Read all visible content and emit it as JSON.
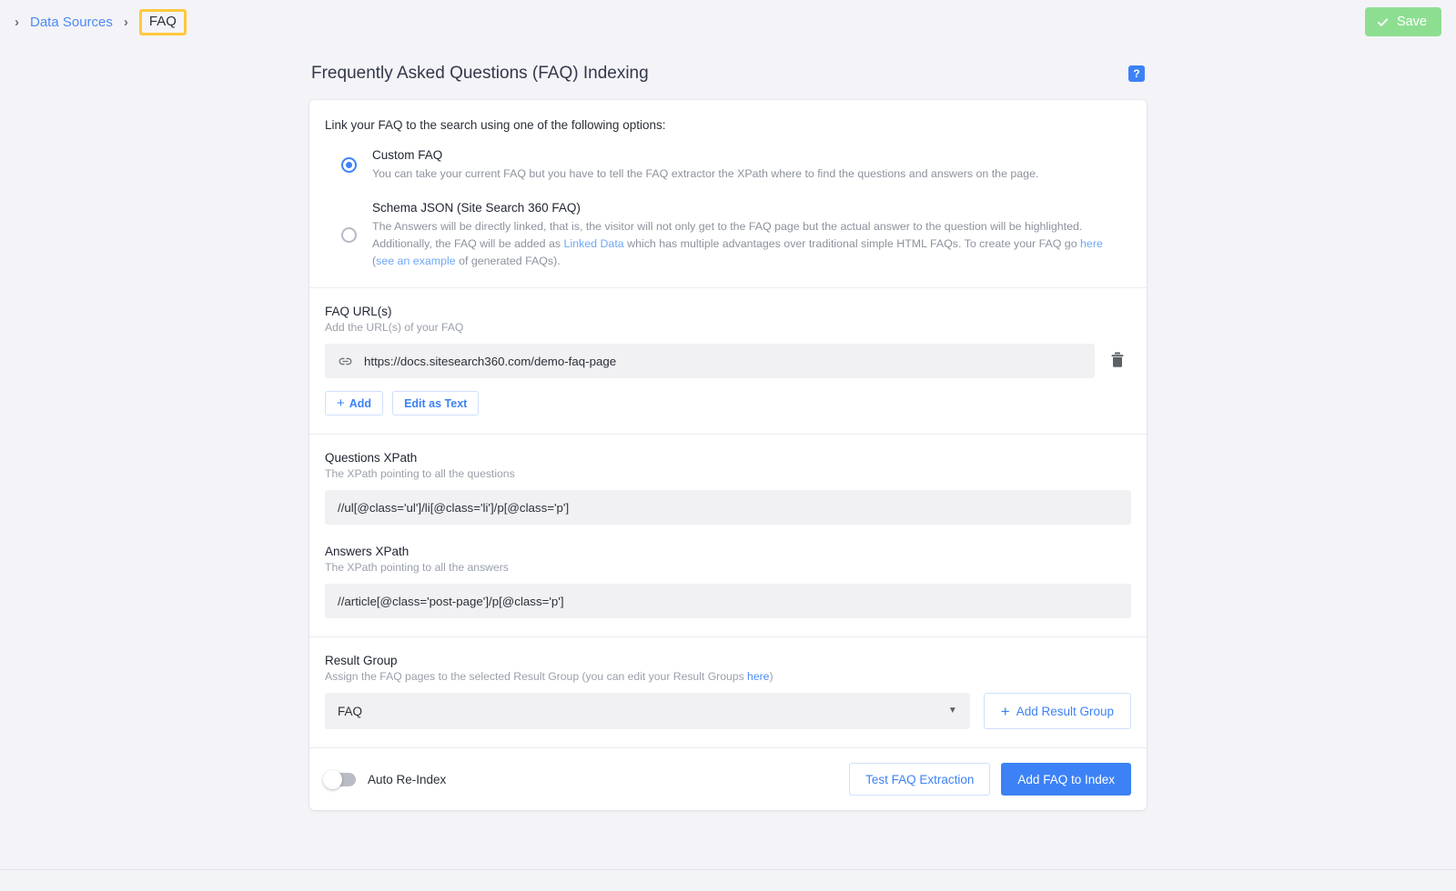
{
  "topbar": {
    "breadcrumb": {
      "leading_chevron": "›",
      "separator": "›",
      "parent_label": "Data Sources",
      "current_label": "FAQ"
    },
    "save_label": "Save",
    "save_color": "#8ede92"
  },
  "page": {
    "title": "Frequently Asked Questions (FAQ) Indexing",
    "help_badge": "?",
    "accent_color": "#3c82f6",
    "highlight_color": "#ffc83d"
  },
  "options_section": {
    "intro": "Link your FAQ to the search using one of the following options:",
    "options": [
      {
        "title": "Custom FAQ",
        "desc": "You can take your current FAQ but you have to tell the FAQ extractor the XPath where to find the questions and answers on the page.",
        "selected": true
      },
      {
        "title": "Schema JSON (Site Search 360 FAQ)",
        "desc_part1": "The Answers will be directly linked, that is, the visitor will not only get to the FAQ page but the actual answer to the question will be highlighted. Additionally, the FAQ will be added as ",
        "link1": "Linked Data",
        "desc_part2": " which has multiple advantages over traditional simple HTML FAQs. To create your FAQ go ",
        "link2": "here",
        "desc_part3": " (",
        "link3": "see an example",
        "desc_part4": " of generated FAQs).",
        "selected": false
      }
    ]
  },
  "faq_urls": {
    "label": "FAQ URL(s)",
    "hint": "Add the URL(s) of your FAQ",
    "url_value": "https://docs.sitesearch360.com/demo-faq-page",
    "link_icon": "link-icon",
    "delete_icon": "trash-icon",
    "add_label": "Add",
    "add_plus": "+",
    "edit_as_text_label": "Edit as Text"
  },
  "questions_xpath": {
    "label": "Questions XPath",
    "hint": "The XPath pointing to all the questions",
    "value": "//ul[@class='ul']/li[@class='li']/p[@class='p']"
  },
  "answers_xpath": {
    "label": "Answers XPath",
    "hint": "The XPath pointing to all the answers",
    "value": "//article[@class='post-page']/p[@class='p']"
  },
  "result_group": {
    "label": "Result Group",
    "hint_part1": "Assign the FAQ pages to the selected Result Group (you can edit your Result Groups ",
    "hint_link": "here",
    "hint_part2": ")",
    "selected_value": "FAQ",
    "caret": "▼",
    "add_button_label": "Add Result Group",
    "add_button_plus": "+"
  },
  "footer": {
    "auto_reindex_label": "Auto Re-Index",
    "auto_reindex_on": false,
    "test_button_label": "Test FAQ Extraction",
    "primary_button_label": "Add FAQ to Index"
  }
}
